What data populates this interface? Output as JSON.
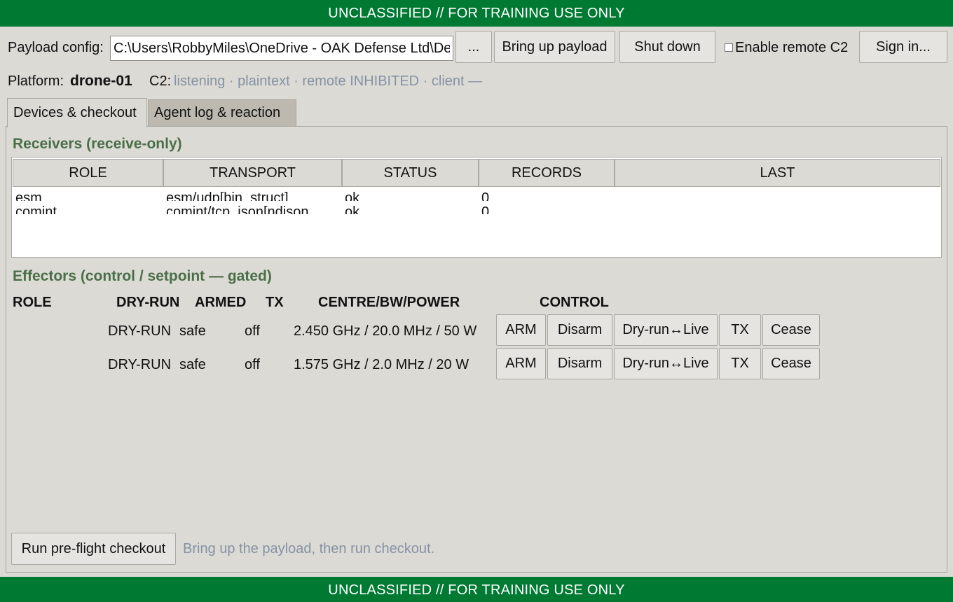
{
  "banner": {
    "text": "UNCLASSIFIED // FOR TRAINING USE ONLY"
  },
  "toolbar": {
    "config_label": "Payload config:",
    "config_value": "C:\\Users\\RobbyMiles\\OneDrive - OAK Defense Ltd\\Desktop",
    "browse_label": "...",
    "bring_up_label": "Bring up payload",
    "shutdown_label": "Shut down",
    "remote_c2_label": "Enable remote C2",
    "remote_c2_checked": false,
    "sign_in_label": "Sign in..."
  },
  "status": {
    "platform_label": "Platform:",
    "platform_value": "drone-01",
    "c2_label": "C2:",
    "c2_value": "listening · plaintext · remote INHIBITED · client —"
  },
  "tabs": [
    {
      "label": "Devices & checkout",
      "active": true
    },
    {
      "label": "Agent log & reaction",
      "active": false
    }
  ],
  "receivers": {
    "title": "Receivers (receive-only)",
    "columns": [
      "ROLE",
      "TRANSPORT",
      "STATUS",
      "RECORDS",
      "LAST"
    ],
    "rows": [
      [
        "esm",
        "esm/udp[bin_struct]",
        "ok",
        "0",
        ""
      ],
      [
        "comint",
        "comint/tcp_json[ndjson",
        "ok",
        "0",
        ""
      ]
    ]
  },
  "effectors": {
    "title": "Effectors (control / setpoint — gated)",
    "columns": [
      "ROLE",
      "DRY-RUN",
      "ARMED",
      "TX",
      "CENTRE/BW/POWER",
      "CONTROL"
    ],
    "buttons": [
      "ARM",
      "Disarm",
      "Dry-run↔Live",
      "TX",
      "Cease"
    ],
    "rows": [
      {
        "role": "",
        "dryrun": "DRY-RUN",
        "armed": "safe",
        "tx": "off",
        "cbp": "2.450 GHz / 20.0 MHz / 50 W"
      },
      {
        "role": "",
        "dryrun": "DRY-RUN",
        "armed": "safe",
        "tx": "off",
        "cbp": "1.575 GHz / 2.0 MHz / 20 W"
      }
    ]
  },
  "checkout": {
    "button_label": "Run pre-flight checkout",
    "hint": "Bring up the payload, then run checkout."
  }
}
